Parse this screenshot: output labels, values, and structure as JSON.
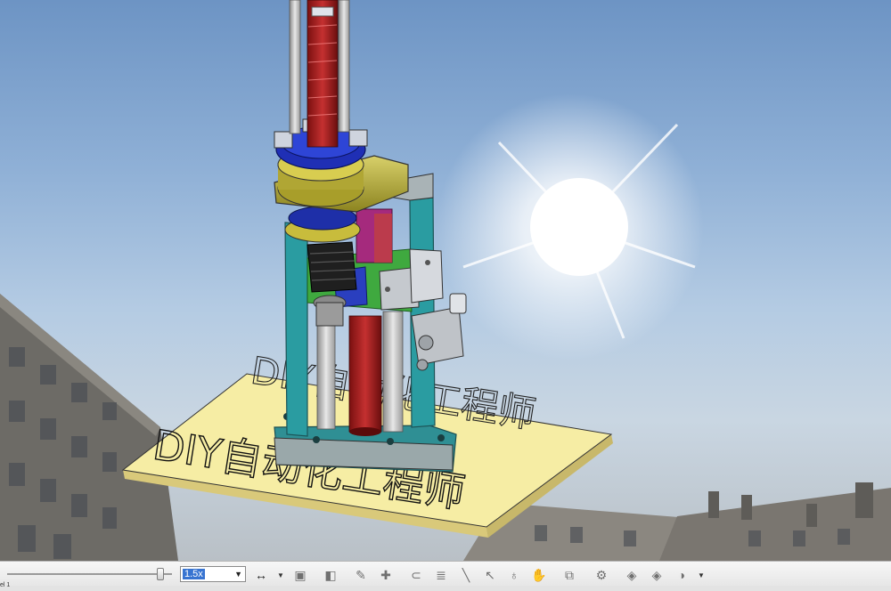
{
  "board_text": {
    "front": "DIY自动化工程师",
    "back": "DIY自动化工程师"
  },
  "toolbar": {
    "zoom_value": "1.5x",
    "zoom_position": 0.93
  },
  "statusbar": {
    "text": "el 1"
  },
  "icons": [
    "fit-width-icon",
    "dropdown-arrow-icon",
    "view-orientation-icon",
    "section-view-icon",
    "pencil-icon",
    "markup-icon",
    "measure-icon",
    "list-icon",
    "line-icon",
    "select-arrow-icon",
    "light-icon",
    "hand-icon",
    "camera-icon",
    "settings-gear-icon",
    "cube-view-icon",
    "cube-view-2-icon",
    "display-style-icon",
    "dropdown-arrow-icon"
  ]
}
